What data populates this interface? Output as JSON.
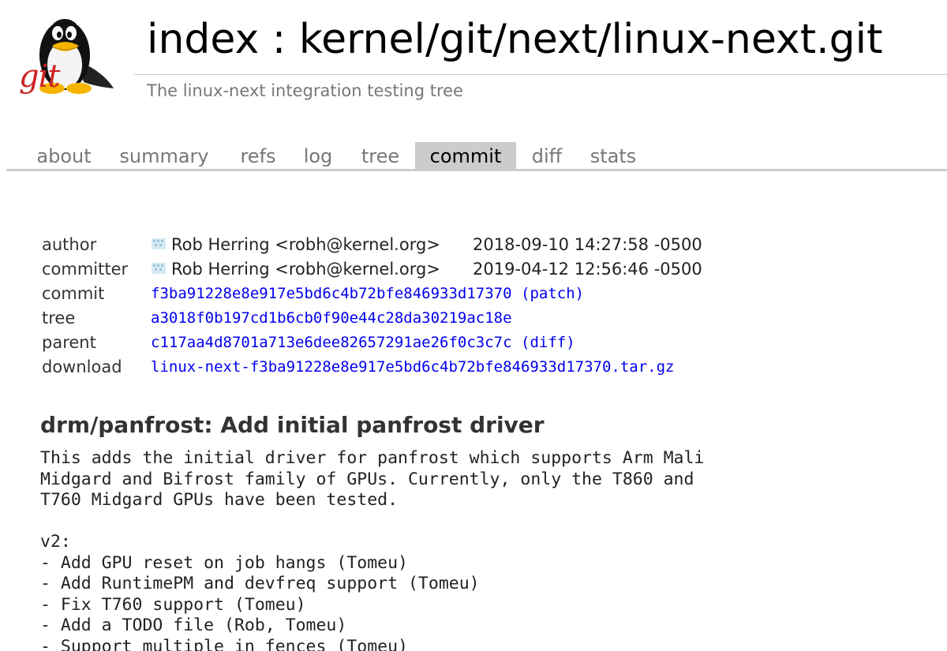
{
  "header": {
    "logo_text": "git",
    "title": "index : kernel/git/next/linux-next.git",
    "subtitle": "The linux-next integration testing tree"
  },
  "tabs": [
    {
      "label": "about",
      "active": false
    },
    {
      "label": "summary",
      "active": false
    },
    {
      "label": "refs",
      "active": false
    },
    {
      "label": "log",
      "active": false
    },
    {
      "label": "tree",
      "active": false
    },
    {
      "label": "commit",
      "active": true
    },
    {
      "label": "diff",
      "active": false
    },
    {
      "label": "stats",
      "active": false
    }
  ],
  "commit_info": {
    "author": {
      "label": "author",
      "name": "Rob Herring <robh@kernel.org>",
      "date": "2018-09-10 14:27:58 -0500"
    },
    "committer": {
      "label": "committer",
      "name": "Rob Herring <robh@kernel.org>",
      "date": "2019-04-12 12:56:46 -0500"
    },
    "commit": {
      "label": "commit",
      "hash": "f3ba91228e8e917e5bd6c4b72bfe846933d17370",
      "extra_link": "patch"
    },
    "tree": {
      "label": "tree",
      "hash": "a3018f0b197cd1b6cb0f90e44c28da30219ac18e"
    },
    "parent": {
      "label": "parent",
      "hash": "c117aa4d8701a713e6dee82657291ae26f0c3c7c",
      "extra_link": "diff"
    },
    "download": {
      "label": "download",
      "file": "linux-next-f3ba91228e8e917e5bd6c4b72bfe846933d17370.tar.gz"
    }
  },
  "subject": "drm/panfrost: Add initial panfrost driver",
  "message_lines": [
    "This adds the initial driver for panfrost which supports Arm Mali",
    "Midgard and Bifrost family of GPUs. Currently, only the T860 and",
    "T760 Midgard GPUs have been tested.",
    "",
    "v2:",
    "- Add GPU reset on job hangs (Tomeu)",
    "- Add RuntimePM and devfreq support (Tomeu)",
    "- Fix T760 support (Tomeu)",
    "- Add a TODO file (Rob, Tomeu)",
    "- Support multiple in fences (Tomeu)"
  ]
}
